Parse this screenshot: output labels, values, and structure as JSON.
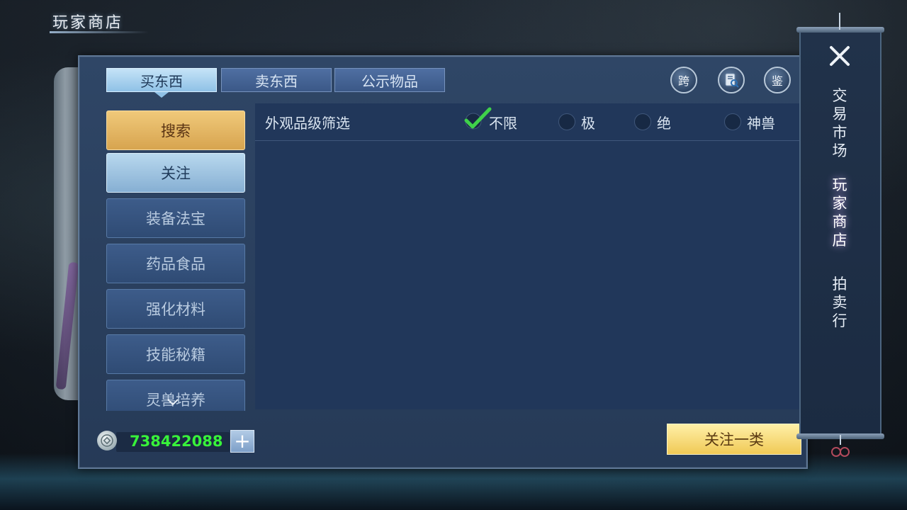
{
  "page": {
    "title": "玩家商店"
  },
  "tabs": [
    {
      "label": "买东西",
      "active": true
    },
    {
      "label": "卖东西",
      "active": false
    },
    {
      "label": "公示物品",
      "active": false
    }
  ],
  "header_buttons": [
    {
      "label": "跨",
      "icon": "cross-server-icon"
    },
    {
      "label": "",
      "icon": "search-book-icon"
    },
    {
      "label": "鉴",
      "icon": "appraise-icon"
    }
  ],
  "categories": [
    {
      "label": "搜索",
      "state": "highlight"
    },
    {
      "label": "关注",
      "state": "selected"
    },
    {
      "label": "装备法宝",
      "state": "normal"
    },
    {
      "label": "药品食品",
      "state": "normal"
    },
    {
      "label": "强化材料",
      "state": "normal"
    },
    {
      "label": "技能秘籍",
      "state": "normal"
    },
    {
      "label": "灵兽培养",
      "state": "normal"
    }
  ],
  "filter": {
    "label": "外观品级筛选",
    "options": [
      {
        "label": "不限",
        "checked": true
      },
      {
        "label": "极",
        "checked": false
      },
      {
        "label": "绝",
        "checked": false
      },
      {
        "label": "神兽",
        "checked": false
      }
    ]
  },
  "currency": {
    "amount": "738422088",
    "add_label": "+",
    "color": "#38f23a"
  },
  "actions": {
    "follow_category": "关注一类"
  },
  "side_nav": [
    {
      "label": "交易市场",
      "active": false
    },
    {
      "label": "玩家商店",
      "active": true
    },
    {
      "label": "拍卖行",
      "active": false
    }
  ]
}
